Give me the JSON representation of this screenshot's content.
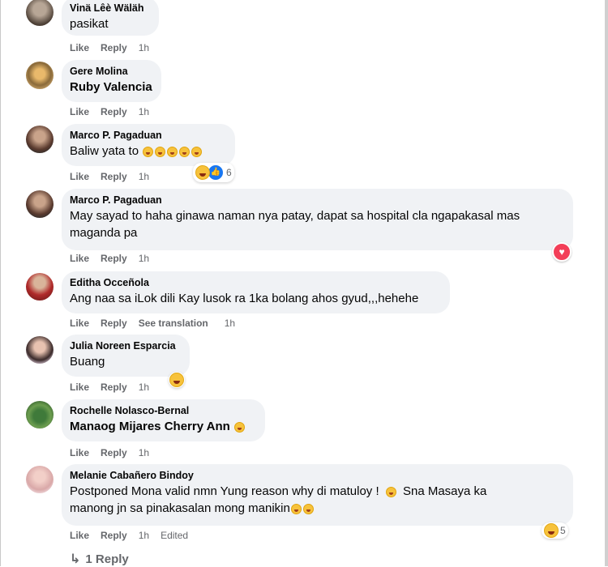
{
  "actions": {
    "like": "Like",
    "reply": "Reply",
    "see_translation": "See translation",
    "edited": "Edited"
  },
  "comments": [
    {
      "author": "Vinä Lêè Wäläh",
      "text": "pasikat",
      "time": "1h"
    },
    {
      "author": "Gere Molina",
      "text": "Ruby Valencia",
      "time": "1h"
    },
    {
      "author": "Marco P. Pagaduan",
      "text": "Baliw yata to",
      "time": "1h",
      "reaction_count": "6"
    },
    {
      "author": "Marco P. Pagaduan",
      "text_line1": "May sayad to haha ginawa naman nya patay, dapat sa hospital cla ngapakasal mas",
      "text_line2": "maganda pa",
      "time": "1h"
    },
    {
      "author": "Editha Occeñola",
      "text": "Ang naa sa iLok dili Kay lusok ra 1ka bolang ahos gyud,,,hehehe",
      "time": "1h"
    },
    {
      "author": "Julia Noreen Esparcia",
      "text": "Buang",
      "time": "1h"
    },
    {
      "author": "Rochelle Nolasco-Bernal",
      "text": "Manaog Mijares Cherry Ann",
      "time": "1h"
    },
    {
      "author": "Melanie Cabañero Bindoy",
      "text_line1": "Postponed Mona valid nmn Yung reason why di matuloy !",
      "text_line1b": "Sna Masaya ka",
      "text_line2": "manong jn sa pinakasalan mong manikin",
      "time": "1h",
      "reaction_count": "5"
    }
  ],
  "replies": {
    "label": "1 Reply"
  },
  "icons": {
    "reply_arrow": "reply-arrow-icon",
    "haha": "haha-reaction-icon",
    "like": "like-reaction-icon",
    "love": "love-reaction-icon"
  },
  "colors": {
    "bubble": "#f0f2f5",
    "secondary_text": "#65676b",
    "like_blue": "#1877f2",
    "love_red": "#f33e58"
  }
}
